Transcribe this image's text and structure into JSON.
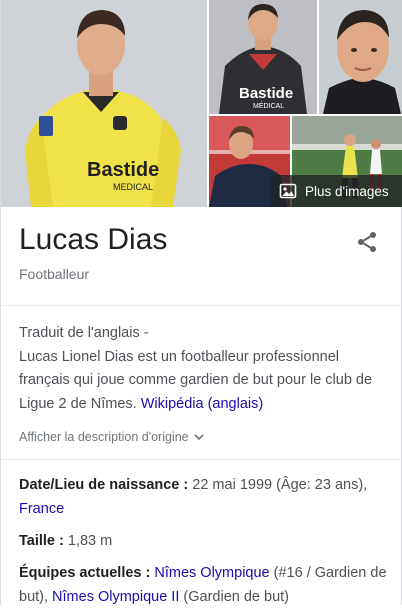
{
  "images": {
    "more_label": "Plus d'images",
    "main_shirt_text": "Bastide",
    "main_shirt_sub": "MEDICAL",
    "alt_shirt_text": "Bastide",
    "alt_shirt_sub": "MÉDICAL"
  },
  "header": {
    "title": "Lucas Dias",
    "subtitle": "Footballeur"
  },
  "description": {
    "prefix": "Traduit de l'anglais -",
    "body": "Lucas Lionel Dias est un footballeur professionnel français qui joue comme gardien de but pour le club de Ligue 2 de Nîmes.",
    "source_link": "Wikipédia (anglais)",
    "show_original": "Afficher la description d'origine"
  },
  "facts": {
    "birth_label": "Date/Lieu de naissance :",
    "birth_value": "22 mai 1999 (Âge: 23 ans),",
    "birth_place": "France",
    "height_label": "Taille :",
    "height_value": "1,83 m",
    "teams_label": "Équipes actuelles :",
    "team1": "Nîmes Olympique",
    "team1_detail": "(#16 / Gardien de but),",
    "team2": "Nîmes Olympique II",
    "team2_detail": "(Gardien de but)"
  }
}
